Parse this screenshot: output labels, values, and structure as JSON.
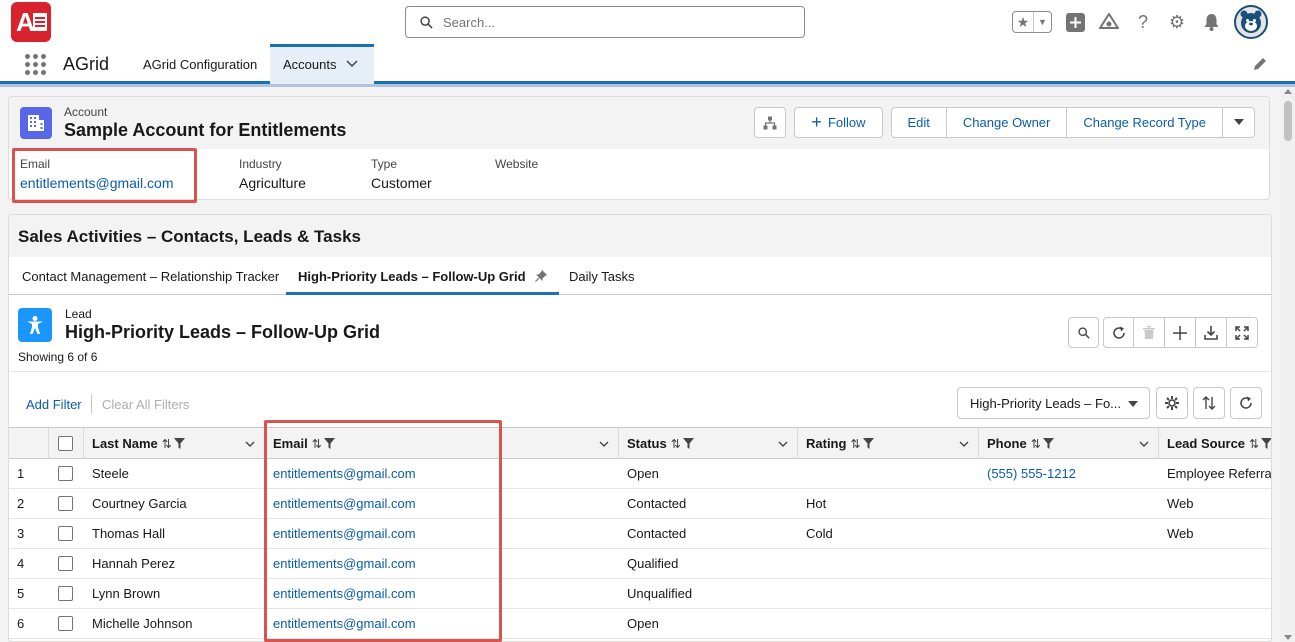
{
  "brand": {
    "logo_letter": "A"
  },
  "search": {
    "placeholder": "Search..."
  },
  "header_icons": [
    "star-icon",
    "chevron-down-icon",
    "add-icon",
    "trailhead-icon",
    "help-icon",
    "settings-icon",
    "notifications-icon",
    "avatar"
  ],
  "app": {
    "name": "AGrid"
  },
  "nav": {
    "items": [
      {
        "label": "AGrid Configuration"
      },
      {
        "label": "Accounts",
        "active": true
      }
    ]
  },
  "account": {
    "type": "Account",
    "name": "Sample Account for Entitlements",
    "actions": {
      "follow": "Follow",
      "edit": "Edit",
      "change_owner": "Change Owner",
      "change_record_type": "Change Record Type"
    },
    "fields": [
      {
        "label": "Email",
        "value": "entitlements@gmail.com"
      },
      {
        "label": "Industry",
        "value": "Agriculture"
      },
      {
        "label": "Type",
        "value": "Customer"
      },
      {
        "label": "Website",
        "value": ""
      }
    ]
  },
  "sales": {
    "title": "Sales Activities – Contacts, Leads & Tasks",
    "tabs": [
      {
        "label": "Contact Management – Relationship Tracker"
      },
      {
        "label": "High-Priority Leads – Follow-Up Grid",
        "active": true
      },
      {
        "label": "Daily Tasks"
      }
    ]
  },
  "grid": {
    "object": "Lead",
    "title": "High-Priority Leads – Follow-Up Grid",
    "showing": "Showing 6 of 6",
    "add_filter": "Add Filter",
    "clear_filters": "Clear All Filters",
    "view_name": "High-Priority Leads – Fo...",
    "columns": [
      "Last Name",
      "Email",
      "Status",
      "Rating",
      "Phone",
      "Lead Source"
    ],
    "rows": [
      {
        "num": "1",
        "last_name": "Steele",
        "email": "entitlements@gmail.com",
        "status": "Open",
        "rating": "",
        "phone": "(555) 555-1212",
        "lead_source": "Employee Referral"
      },
      {
        "num": "2",
        "last_name": "Courtney Garcia",
        "email": "entitlements@gmail.com",
        "status": "Contacted",
        "rating": "Hot",
        "phone": "",
        "lead_source": "Web"
      },
      {
        "num": "3",
        "last_name": "Thomas Hall",
        "email": "entitlements@gmail.com",
        "status": "Contacted",
        "rating": "Cold",
        "phone": "",
        "lead_source": "Web"
      },
      {
        "num": "4",
        "last_name": "Hannah Perez",
        "email": "entitlements@gmail.com",
        "status": "Qualified",
        "rating": "",
        "phone": "",
        "lead_source": ""
      },
      {
        "num": "5",
        "last_name": "Lynn Brown",
        "email": "entitlements@gmail.com",
        "status": "Unqualified",
        "rating": "",
        "phone": "",
        "lead_source": ""
      },
      {
        "num": "6",
        "last_name": "Michelle Johnson",
        "email": "entitlements@gmail.com",
        "status": "Open",
        "rating": "",
        "phone": "",
        "lead_source": ""
      }
    ]
  },
  "colors": {
    "brand_red": "#d8222e",
    "accent_blue": "#1b6fb5",
    "link": "#0b5cab",
    "highlight": "#d9534f",
    "account_icon": "#5867e8",
    "lead_icon": "#1b96ff"
  }
}
